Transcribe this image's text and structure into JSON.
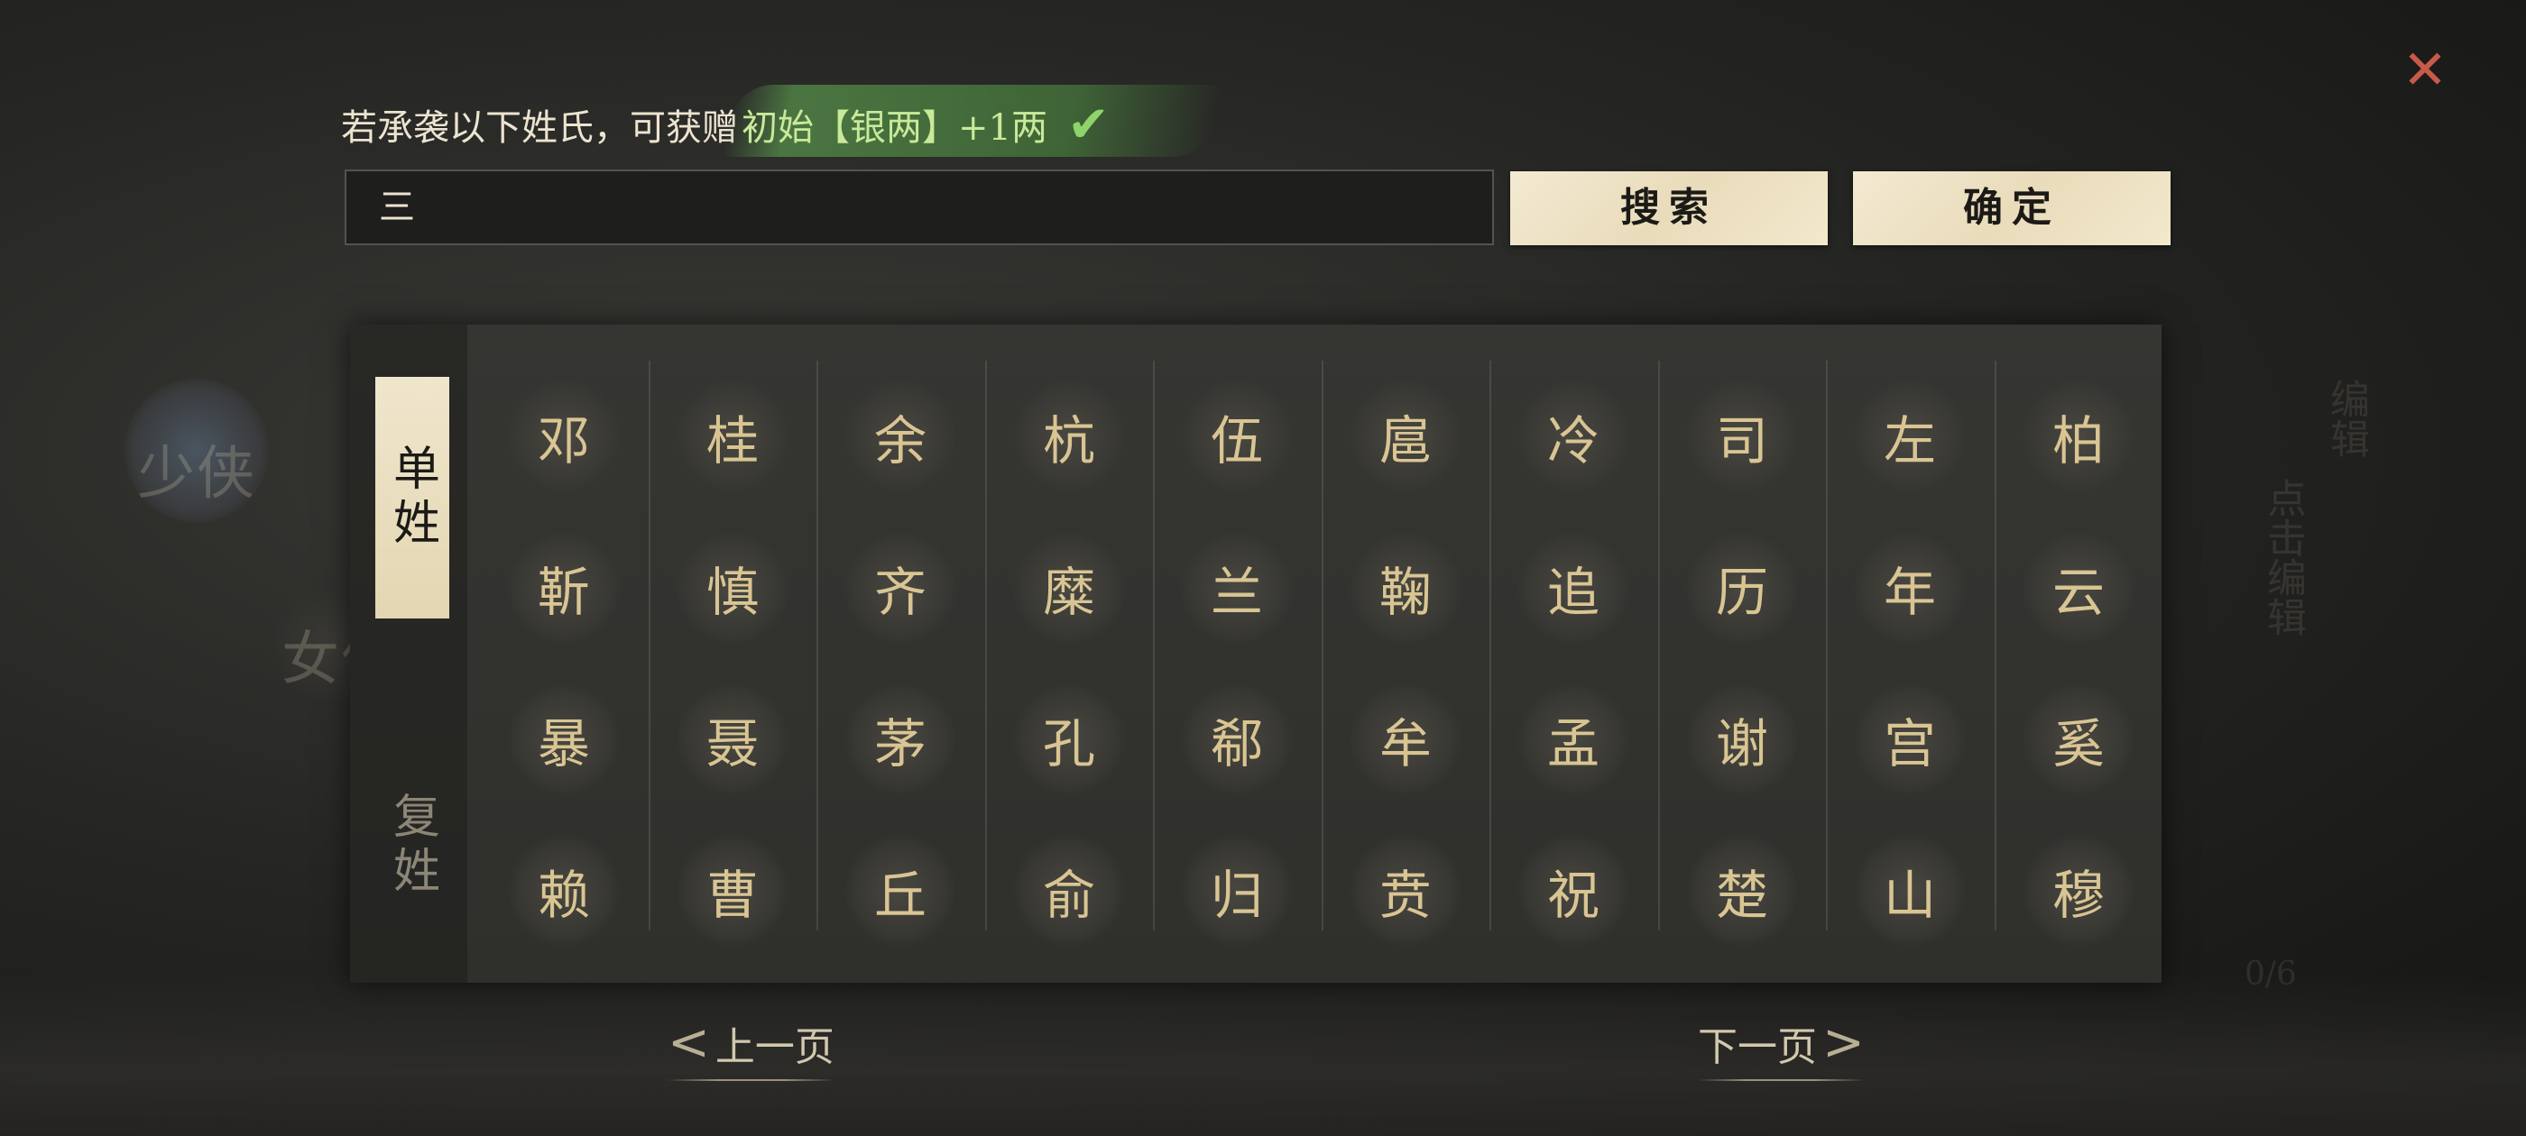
{
  "promo": {
    "prefix": "若承袭以下姓氏，可获赠",
    "highlight": "初始【银两】+1两",
    "check_icon": "check-icon"
  },
  "search": {
    "value": "三",
    "button_label": "搜索"
  },
  "confirm_label": "确定",
  "close_icon": "close-icon",
  "tabs": {
    "single": "单姓",
    "compound": "复姓"
  },
  "background": {
    "left_tab_1": "少侠",
    "left_tab_2": "女侠",
    "right_text_1": "编辑",
    "right_text_2": "点击编辑",
    "page_counter": "0/6"
  },
  "surnames": [
    [
      "邓",
      "桂",
      "余",
      "杭",
      "伍",
      "扈",
      "冷",
      "司",
      "左",
      "柏"
    ],
    [
      "靳",
      "慎",
      "齐",
      "糜",
      "兰",
      "鞠",
      "追",
      "历",
      "年",
      "云"
    ],
    [
      "暴",
      "聂",
      "茅",
      "孔",
      "郗",
      "牟",
      "孟",
      "谢",
      "宫",
      "奚"
    ],
    [
      "赖",
      "曹",
      "丘",
      "俞",
      "归",
      "贲",
      "祝",
      "楚",
      "山",
      "穆"
    ]
  ],
  "pagination": {
    "prev": "上一页",
    "next": "下一页",
    "prev_arrow": "<",
    "next_arrow": ">"
  },
  "colors": {
    "accent_gold": "#d9c593",
    "button_bg": "#efe6cc",
    "highlight_green": "#c9e99a",
    "close_red": "#c85a4a"
  }
}
